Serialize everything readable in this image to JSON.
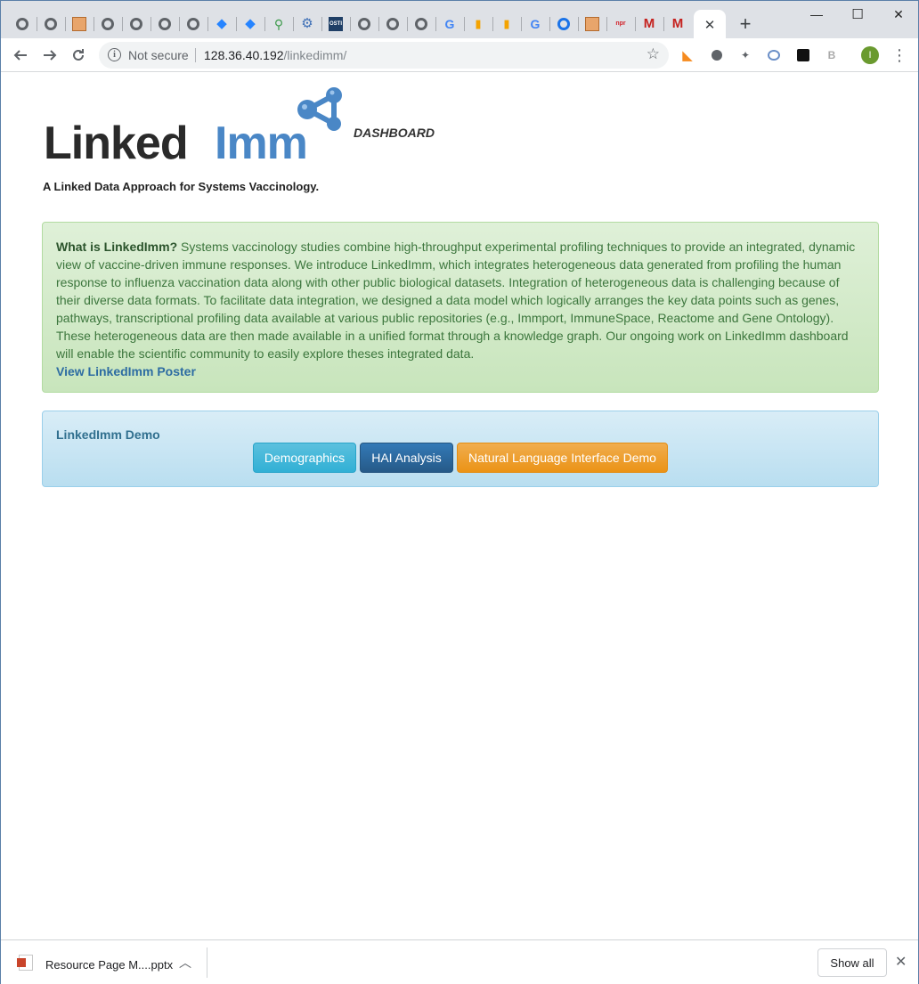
{
  "browser": {
    "tab_favicons": [
      "globe-icon",
      "globe-icon",
      "pattern-icon",
      "globe-icon",
      "globe-icon",
      "globe-icon",
      "globe-icon",
      "jira-icon",
      "jira-icon",
      "search-icon",
      "gear-icon",
      "osti-icon",
      "globe-icon",
      "globe-icon",
      "globe-icon",
      "google-icon",
      "analytics-icon",
      "analytics-icon",
      "google-icon",
      "cloud-icon",
      "pattern-icon",
      "npr-icon",
      "gmail-icon",
      "gmail-icon"
    ],
    "osti_label": "OSTI",
    "npr_label": "npr",
    "active_tab_close": "✕",
    "new_tab": "+",
    "window_controls": {
      "minimize": "—",
      "maximize": "☐",
      "close": "✕"
    },
    "address": {
      "security_label": "Not secure",
      "host": "128.36.40.192",
      "path": "/linkedimm/"
    },
    "profile_initial": "I"
  },
  "page": {
    "logo": {
      "linked": "Linked",
      "imm": "Imm",
      "dashboard": "DASHBOARD"
    },
    "tagline": "A Linked Data Approach for Systems Vaccinology.",
    "about": {
      "heading": "What is LinkedImm?",
      "body": "Systems vaccinology studies combine high-throughput experimental profiling techniques to provide an integrated, dynamic view of vaccine-driven immune responses. We introduce LinkedImm, which integrates heterogeneous data generated from profiling the human response to influenza vaccination data along with other public biological datasets. Integration of heterogeneous data is challenging because of their diverse data formats. To facilitate data integration, we designed a data model which logically arranges the key data points such as genes, pathways, transcriptional profiling data available at various public repositories (e.g., Immport, ImmuneSpace, Reactome and Gene Ontology). These heterogeneous data are then made available in a unified format through a knowledge graph. Our ongoing work on LinkedImm dashboard will enable the scientific community to easily explore theses integrated data.",
      "poster_link": "View LinkedImm Poster"
    },
    "demo": {
      "title": "LinkedImm Demo",
      "buttons": [
        "Demographics",
        "HAI Analysis",
        "Natural Language Interface Demo"
      ]
    }
  },
  "downloads": {
    "file_name": "Resource Page M....pptx",
    "show_all": "Show all"
  },
  "colors": {
    "brand_blue": "#4a87c6",
    "btn_info": "#5bc0de",
    "btn_primary": "#337ab7",
    "btn_warning": "#f0ad4e"
  }
}
